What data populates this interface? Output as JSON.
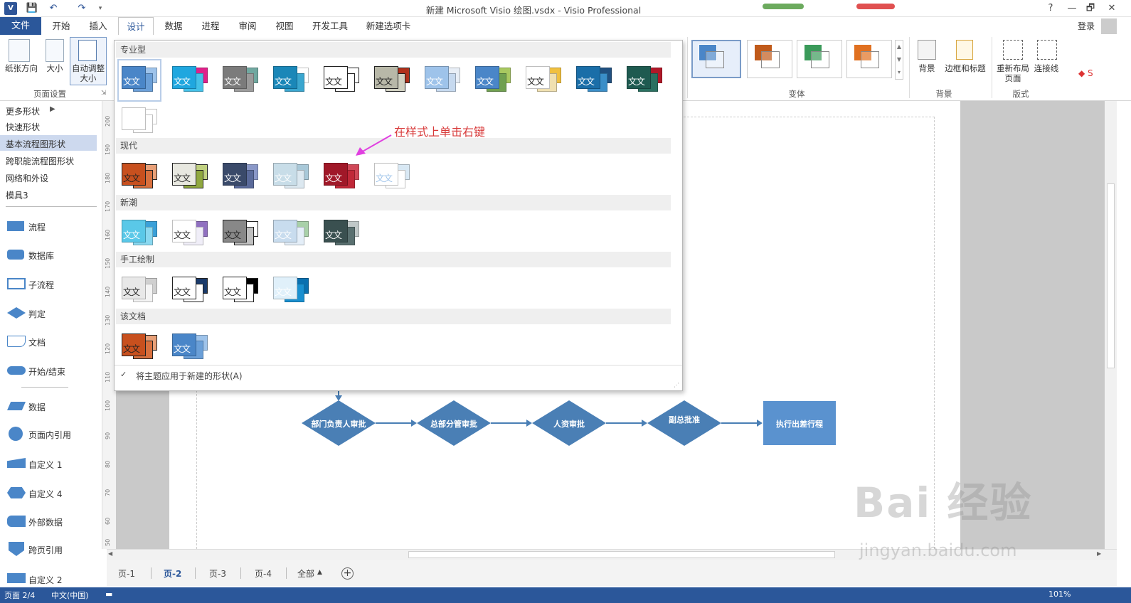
{
  "title_bar": {
    "app_icon": "V",
    "title": "新建 Microsoft Visio 绘图.vsdx - Visio Professional",
    "help": "?",
    "restore": "🗗",
    "close": "✕"
  },
  "ribbon_tabs": [
    "文件",
    "开始",
    "插入",
    "设计",
    "数据",
    "进程",
    "审阅",
    "视图",
    "开发工具",
    "新建选项卡"
  ],
  "login": "登录",
  "ribbon": {
    "page_setup": {
      "orientation": "纸张方向",
      "size": "大小",
      "auto_size": "自动调整大小",
      "group": "页面设置"
    },
    "variants_group": "变体",
    "background": {
      "bg": "背景",
      "borders": "边框和标题",
      "group": "背景"
    },
    "layout": {
      "relayout": "重新布局页面",
      "connectors": "连接线",
      "group": "版式"
    },
    "variant_colors": [
      "#4a86c8",
      "#c05a1a",
      "#3a9a5a",
      "#e07020"
    ]
  },
  "shapes_pane": {
    "nav": [
      "更多形状",
      "快速形状",
      "基本流程图形状",
      "跨职能流程图形状",
      "网络和外设",
      "模具3"
    ],
    "shapes": [
      "流程",
      "数据库",
      "子流程",
      "判定",
      "文档",
      "开始/结束",
      "数据",
      "页面内引用",
      "自定义 1",
      "自定义 4",
      "外部数据",
      "跨页引用",
      "自定义 2"
    ]
  },
  "ruler_ticks": [
    "200",
    "190",
    "180",
    "170",
    "160",
    "150",
    "140",
    "130",
    "120",
    "110",
    "100",
    "90",
    "80",
    "70",
    "60",
    "50"
  ],
  "gallery": {
    "sections": [
      "专业型",
      "现代",
      "新潮",
      "手工绘制",
      "该文档"
    ],
    "thumb_text": "文文",
    "footer": "将主题应用于新建的形状(A)",
    "check": "✓"
  },
  "annotation": "在样式上单击右键",
  "flowchart": {
    "steps": [
      "部门负责人审批",
      "总部分管审批",
      "人资审批",
      "副总批准"
    ],
    "final": "执行出差行程"
  },
  "page_tabs": [
    "页-1",
    "页-2",
    "页-3",
    "页-4",
    "全部"
  ],
  "add_page": "+",
  "watermark": "Bai 经验",
  "watermark_url": "jingyan.baidu.com",
  "status": {
    "page": "页面 2/4",
    "lang": "中文(中国)",
    "zoom": "101%"
  }
}
